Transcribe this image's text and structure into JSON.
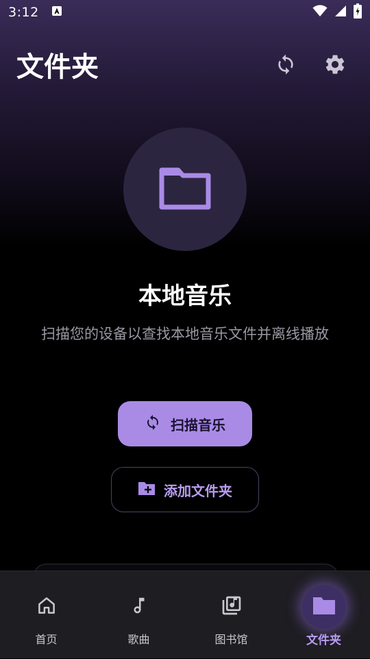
{
  "status_bar": {
    "time": "3:12",
    "notification_icon": "a-letter-icon"
  },
  "header": {
    "title": "文件夹",
    "icons": [
      "sync-icon",
      "gear-icon"
    ]
  },
  "empty_state": {
    "icon": "folder-icon",
    "title": "本地音乐",
    "description": "扫描您的设备以查找本地音乐文件并离线播放"
  },
  "actions": {
    "scan_label": "扫描音乐",
    "add_folder_label": "添加文件夹"
  },
  "nav": {
    "items": [
      {
        "label": "首页",
        "icon": "home-icon"
      },
      {
        "label": "歌曲",
        "icon": "music-note-icon"
      },
      {
        "label": "图书馆",
        "icon": "library-icon"
      },
      {
        "label": "文件夹",
        "icon": "folder-icon"
      }
    ],
    "active_index": 3
  },
  "colors": {
    "accent": "#a98be6",
    "accent_text": "#b79cf0",
    "background": "#000000",
    "nav_background": "#1e1d22"
  }
}
